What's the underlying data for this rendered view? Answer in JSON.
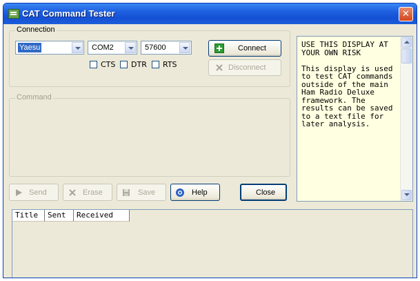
{
  "window": {
    "title": "CAT Command Tester",
    "close_glyph": "✕"
  },
  "connection": {
    "legend": "Connection",
    "radio_select": "Yaesu",
    "port_select": "COM2",
    "baud_select": "57600",
    "checkboxes": [
      {
        "label": "CTS",
        "checked": false
      },
      {
        "label": "DTR",
        "checked": false
      },
      {
        "label": "RTS",
        "checked": false
      }
    ],
    "connect_label": "Connect",
    "disconnect_label": "Disconnect"
  },
  "command": {
    "legend": "Command"
  },
  "toolbar": {
    "send_label": "Send",
    "erase_label": "Erase",
    "save_label": "Save",
    "help_label": "Help",
    "close_label": "Close"
  },
  "info_text": "USE THIS DISPLAY AT YOUR OWN RISK\n\nThis display is used to test CAT commands outside of the main Ham Radio Deluxe framework. The results can be saved to a text file for later analysis.",
  "results": {
    "columns": [
      "Title",
      "Sent",
      "Received"
    ]
  },
  "colors": {
    "titlebar": "#1d5fe0",
    "window_bg": "#ece9d8",
    "info_bg": "#ffffe1",
    "selection": "#316ac5",
    "close_button": "#d3461b"
  }
}
